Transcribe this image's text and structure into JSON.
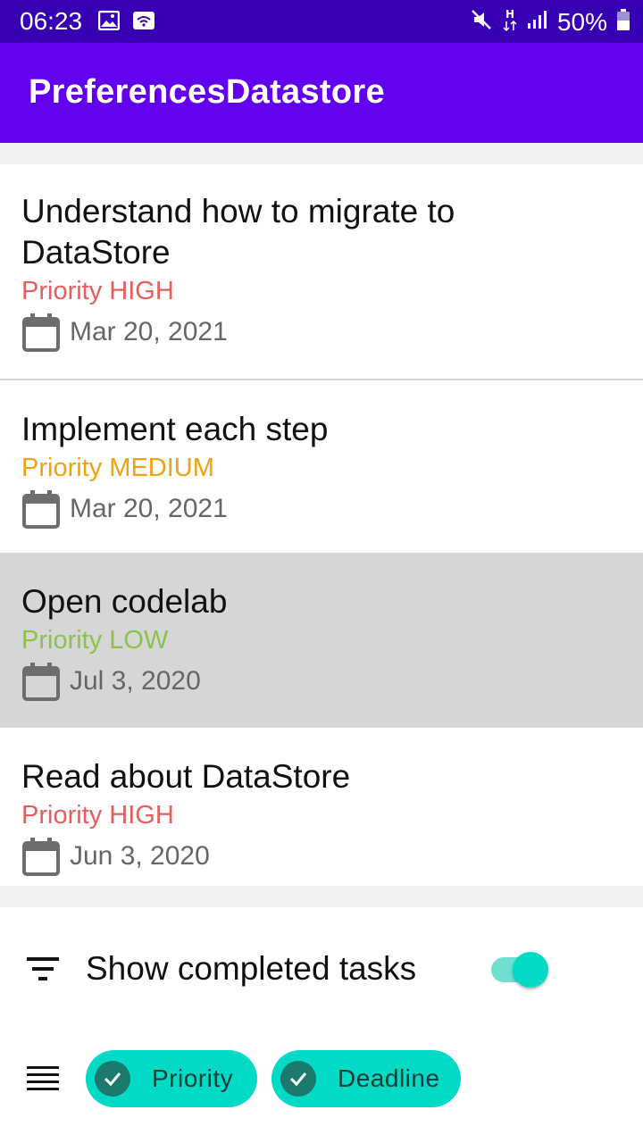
{
  "status_bar": {
    "time": "06:23",
    "battery": "50%",
    "icons": [
      "image-icon",
      "wifi-icon",
      "mute-icon",
      "h-plus-icon",
      "signal-icon",
      "battery-icon"
    ]
  },
  "app_bar": {
    "title": "PreferencesDatastore"
  },
  "tasks": [
    {
      "title": "Understand how to migrate to DataStore",
      "priority": "Priority HIGH",
      "priority_color": "#e85c5c",
      "date": "Mar 20, 2021"
    },
    {
      "title": "Implement each step",
      "priority": "Priority MEDIUM",
      "priority_color": "#f2a20c",
      "date": "Mar 20, 2021"
    },
    {
      "title": "Open codelab",
      "priority": "Priority LOW",
      "priority_color": "#8bc34a",
      "date": "Jul 3, 2020",
      "selected": true
    },
    {
      "title": "Read about DataStore",
      "priority": "Priority HIGH",
      "priority_color": "#e85c5c",
      "date": "Jun 3, 2020"
    }
  ],
  "filter": {
    "label": "Show completed tasks",
    "enabled": true
  },
  "sort": {
    "chips": [
      {
        "label": "Priority",
        "checked": true
      },
      {
        "label": "Deadline",
        "checked": true
      }
    ]
  },
  "colors": {
    "status_bar": "#3700b3",
    "app_bar": "#6200ee",
    "accent": "#03dac5"
  }
}
